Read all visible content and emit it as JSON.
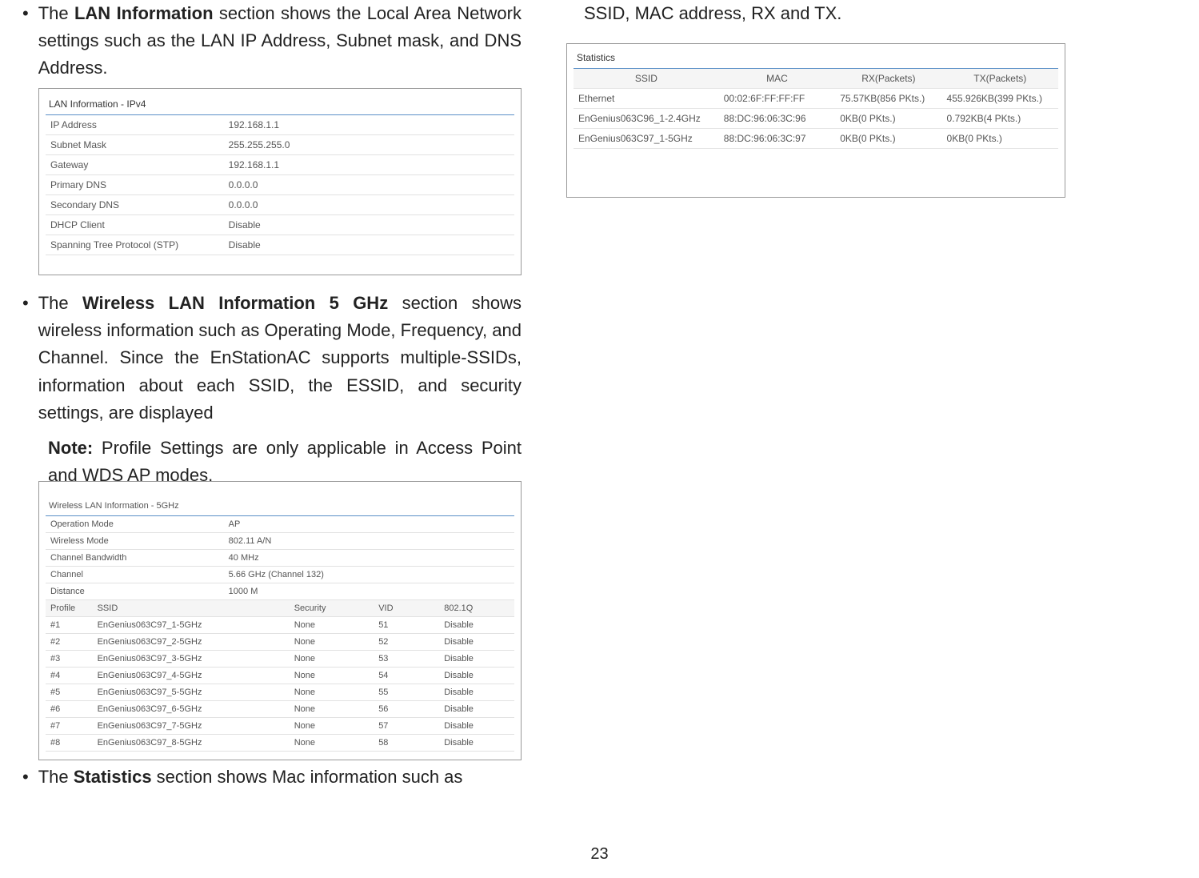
{
  "left": {
    "b1_pre": "The ",
    "b1_bold": "LAN Information",
    "b1_post": " section shows the Local Area Network settings such as the LAN IP Address, Subnet mask, and DNS Address.",
    "lan_title": "LAN Information - IPv4",
    "lan_rows": [
      {
        "k": "IP Address",
        "v": "192.168.1.1"
      },
      {
        "k": "Subnet Mask",
        "v": "255.255.255.0"
      },
      {
        "k": "Gateway",
        "v": "192.168.1.1"
      },
      {
        "k": "Primary DNS",
        "v": "0.0.0.0"
      },
      {
        "k": "Secondary DNS",
        "v": "0.0.0.0"
      },
      {
        "k": "DHCP Client",
        "v": "Disable"
      },
      {
        "k": "Spanning Tree Protocol (STP)",
        "v": "Disable"
      }
    ],
    "b2_pre": "The ",
    "b2_bold": "Wireless LAN Information 5 GHz",
    "b2_post": " section shows wireless information such as Operating Mode, Frequency, and Channel. Since the EnStationAC supports multiple-SSIDs, information about each SSID, the ESSID, and security settings, are displayed",
    "note_bold": "Note:",
    "note_rest": " Profile Settings are only applicable in Access Point and WDS AP modes.",
    "wlan_title": "Wireless LAN Information - 5GHz",
    "wlan_info": [
      {
        "k": "Operation Mode",
        "v": "AP"
      },
      {
        "k": "Wireless Mode",
        "v": "802.11 A/N"
      },
      {
        "k": "Channel Bandwidth",
        "v": "40 MHz"
      },
      {
        "k": "Channel",
        "v": "5.66 GHz (Channel 132)"
      },
      {
        "k": "Distance",
        "v": "1000 M"
      }
    ],
    "wlan_head": {
      "c1": "Profile",
      "c2": "SSID",
      "c3": "Security",
      "c4": "VID",
      "c5": "802.1Q"
    },
    "wlan_rows": [
      {
        "p": "#1",
        "s": "EnGenius063C97_1-5GHz",
        "sec": "None",
        "vid": "51",
        "q": "Disable"
      },
      {
        "p": "#2",
        "s": "EnGenius063C97_2-5GHz",
        "sec": "None",
        "vid": "52",
        "q": "Disable"
      },
      {
        "p": "#3",
        "s": "EnGenius063C97_3-5GHz",
        "sec": "None",
        "vid": "53",
        "q": "Disable"
      },
      {
        "p": "#4",
        "s": "EnGenius063C97_4-5GHz",
        "sec": "None",
        "vid": "54",
        "q": "Disable"
      },
      {
        "p": "#5",
        "s": "EnGenius063C97_5-5GHz",
        "sec": "None",
        "vid": "55",
        "q": "Disable"
      },
      {
        "p": "#6",
        "s": "EnGenius063C97_6-5GHz",
        "sec": "None",
        "vid": "56",
        "q": "Disable"
      },
      {
        "p": "#7",
        "s": "EnGenius063C97_7-5GHz",
        "sec": "None",
        "vid": "57",
        "q": "Disable"
      },
      {
        "p": "#8",
        "s": "EnGenius063C97_8-5GHz",
        "sec": "None",
        "vid": "58",
        "q": "Disable"
      }
    ],
    "b3_pre": "The ",
    "b3_bold": "Statistics",
    "b3_post": " section shows Mac information such as"
  },
  "right": {
    "top_text": "SSID, MAC address, RX and TX.",
    "stats_title": "Statistics",
    "stats_head": {
      "c1": "SSID",
      "c2": "MAC",
      "c3": "RX(Packets)",
      "c4": "TX(Packets)"
    },
    "stats_rows": [
      {
        "s": "Ethernet",
        "m": "00:02:6F:FF:FF:FF",
        "r": "75.57KB(856 PKts.)",
        "t": "455.926KB(399 PKts.)"
      },
      {
        "s": "EnGenius063C96_1-2.4GHz",
        "m": "88:DC:96:06:3C:96",
        "r": "0KB(0 PKts.)",
        "t": "0.792KB(4 PKts.)"
      },
      {
        "s": "EnGenius063C97_1-5GHz",
        "m": "88:DC:96:06:3C:97",
        "r": "0KB(0 PKts.)",
        "t": "0KB(0 PKts.)"
      }
    ]
  },
  "page_number": "23"
}
